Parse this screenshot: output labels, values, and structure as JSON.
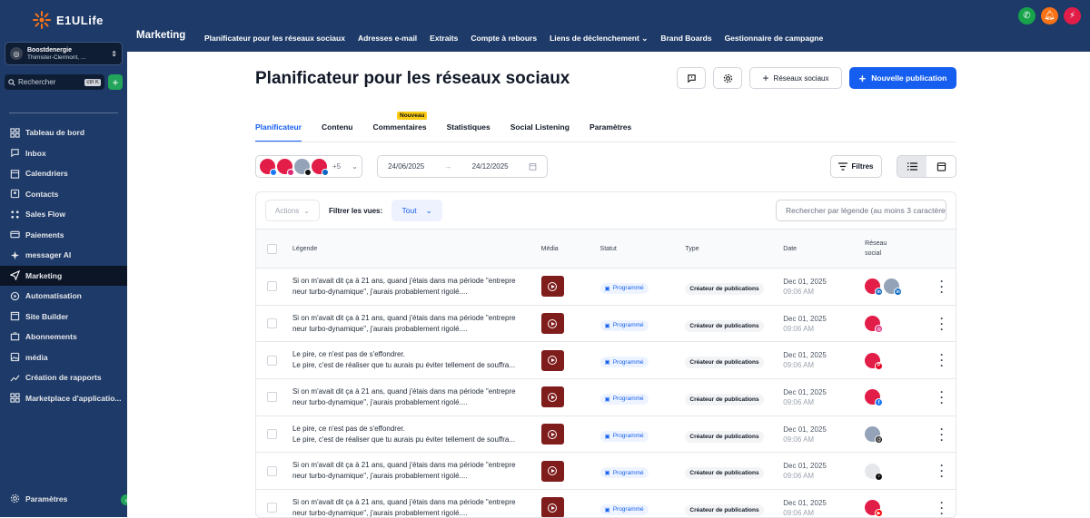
{
  "app": {
    "brand": "E1ULife"
  },
  "account": {
    "name": "Boostdenergie",
    "location": "Thimister-Clermont, ..."
  },
  "sidebar": {
    "search_placeholder": "Rechercher",
    "search_kbd": "ctrl K",
    "items": [
      {
        "label": "Tableau de bord",
        "icon": "dashboard-icon"
      },
      {
        "label": "Inbox",
        "icon": "chat-icon"
      },
      {
        "label": "Calendriers",
        "icon": "calendar-icon"
      },
      {
        "label": "Contacts",
        "icon": "contacts-icon"
      },
      {
        "label": "Sales Flow",
        "icon": "flow-icon"
      },
      {
        "label": "Paiements",
        "icon": "payments-icon"
      },
      {
        "label": "messager AI",
        "icon": "sparkle-icon"
      },
      {
        "label": "Marketing",
        "icon": "send-icon",
        "active": true
      },
      {
        "label": "Automatisation",
        "icon": "automation-icon"
      },
      {
        "label": "Site Builder",
        "icon": "site-icon"
      },
      {
        "label": "Abonnements",
        "icon": "members-icon"
      },
      {
        "label": "média",
        "icon": "image-icon"
      },
      {
        "label": "Création de rapports",
        "icon": "chart-icon"
      },
      {
        "label": "Marketplace d'applicatio...",
        "icon": "grid-icon"
      }
    ],
    "settings_label": "Paramètres"
  },
  "topbar": {
    "section_title": "Marketing",
    "tabs": [
      "Planificateur pour les réseaux sociaux",
      "Adresses e-mail",
      "Extraits",
      "Compte à rebours",
      "Liens de déclenchement",
      "Brand Boards",
      "Gestionnaire de campagne"
    ],
    "colors": {
      "phone": "#16a34a",
      "bell": "#f97316",
      "bolt": "#e11d48"
    }
  },
  "page": {
    "title": "Planificateur pour les réseaux sociaux",
    "social_button": "Réseaux sociaux",
    "new_post_button": "Nouvelle publication",
    "subtabs": [
      "Planificateur",
      "Contenu",
      "Commentaires",
      "Statistiques",
      "Social Listening",
      "Paramètres"
    ],
    "new_badge": "Nouveau",
    "more_accounts": "+5",
    "date_from": "24/06/2025",
    "date_to": "24/12/2025",
    "filters_button": "Filtres"
  },
  "table": {
    "actions_label": "Actions",
    "filter_label": "Filtrer les vues:",
    "filter_value": "Tout",
    "search_placeholder": "Rechercher par légende (au moins 3 caractères)",
    "headers": {
      "caption": "Légende",
      "media": "Média",
      "status": "Statut",
      "type": "Type",
      "date": "Date",
      "network_1": "Réseau",
      "network_2": "social"
    },
    "rows": [
      {
        "l1": "Si on m'avait dit ça à 21 ans, quand j'étais dans ma période \"entrepre",
        "l2": "neur turbo-dynamique\", j'aurais probablement rigolé....",
        "status": "Programmé",
        "type": "Créateur de publications",
        "date": "Dec 01, 2025",
        "time": "09:06 AM",
        "nets": [
          "linkedin",
          "linkedin-photo"
        ]
      },
      {
        "l1": "Si on m'avait dit ça à 21 ans, quand j'étais dans ma période \"entrepre",
        "l2": "neur turbo-dynamique\", j'aurais probablement rigolé....",
        "status": "Programmé",
        "type": "Créateur de publications",
        "date": "Dec 01, 2025",
        "time": "09:06 AM",
        "nets": [
          "instagram"
        ]
      },
      {
        "l1": "Le pire, ce n'est pas de s'effondrer.",
        "l2": "Le pire, c'est de réaliser que tu aurais pu éviter tellement de souffra...",
        "status": "Programmé",
        "type": "Créateur de publications",
        "date": "Dec 01, 2025",
        "time": "09:06 AM",
        "nets": [
          "pinterest"
        ]
      },
      {
        "l1": "Si on m'avait dit ça à 21 ans, quand j'étais dans ma période \"entrepre",
        "l2": "neur turbo-dynamique\", j'aurais probablement rigolé....",
        "status": "Programmé",
        "type": "Créateur de publications",
        "date": "Dec 01, 2025",
        "time": "09:06 AM",
        "nets": [
          "facebook"
        ]
      },
      {
        "l1": "Le pire, ce n'est pas de s'effondrer.",
        "l2": "Le pire, c'est de réaliser que tu aurais pu éviter tellement de souffra...",
        "status": "Programmé",
        "type": "Créateur de publications",
        "date": "Dec 01, 2025",
        "time": "09:06 AM",
        "nets": [
          "threads"
        ]
      },
      {
        "l1": "Si on m'avait dit ça à 21 ans, quand j'étais dans ma période \"entrepre",
        "l2": "neur turbo-dynamique\", j'aurais probablement rigolé....",
        "status": "Programmé",
        "type": "Créateur de publications",
        "date": "Dec 01, 2025",
        "time": "09:06 AM",
        "nets": [
          "tiktok"
        ]
      },
      {
        "l1": "Si on m'avait dit ça à 21 ans, quand j'étais dans ma période \"entrepre",
        "l2": "neur turbo-dynamique\", j'aurais probablement rigolé....",
        "status": "Programmé",
        "type": "Créateur de publications",
        "date": "Dec 01, 2025",
        "time": "09:06 AM",
        "nets": [
          "youtube"
        ]
      }
    ]
  },
  "colors": {
    "primary": "#155eef",
    "sidebar": "#1e3a68",
    "media_thumb": "#7f1d1d"
  }
}
